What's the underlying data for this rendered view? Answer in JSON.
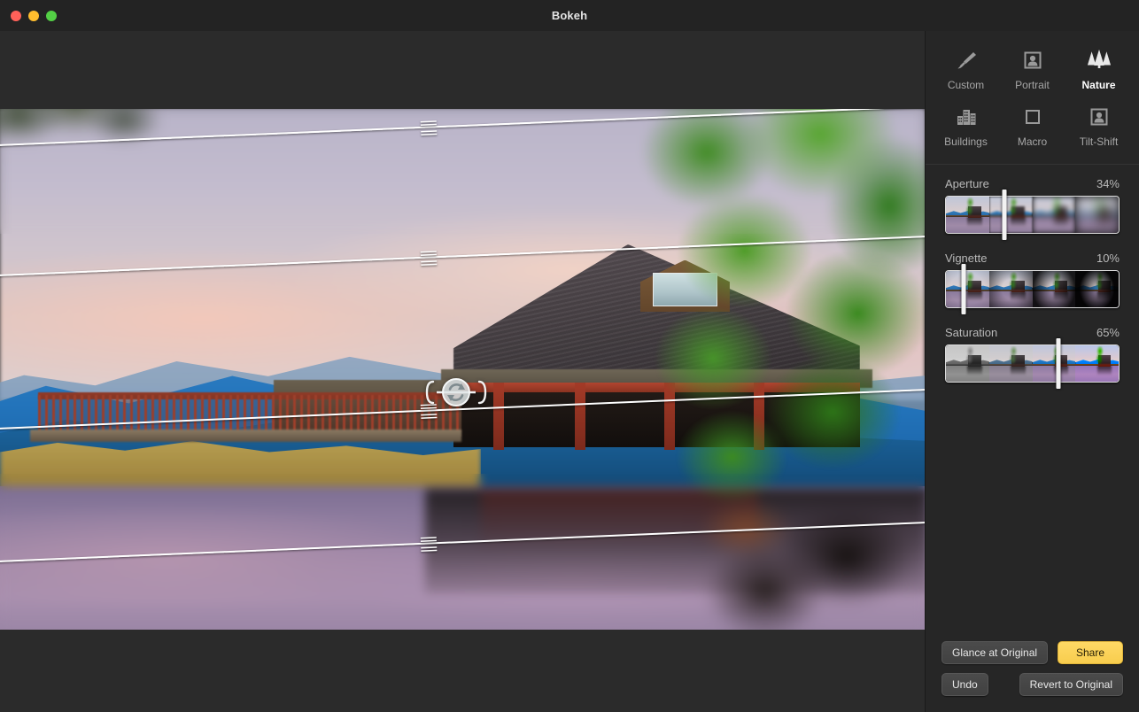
{
  "window": {
    "title": "Bokeh",
    "traffic_lights": [
      {
        "name": "close",
        "color": "#ff6159"
      },
      {
        "name": "minimize",
        "color": "#ffbd2e"
      },
      {
        "name": "zoom",
        "color": "#53cf45"
      }
    ]
  },
  "canvas": {
    "photo_description": "Blurred lakeside wooden lodge with dark tiled roof, red posts and railing, blue mountains and pastel sunset sky reflected in still water",
    "guide_lines": [
      {
        "name": "focus-line-1",
        "top_pct": 3.0,
        "angle_deg": -2.4
      },
      {
        "name": "focus-line-2",
        "top_pct": 28.0,
        "angle_deg": -2.4
      },
      {
        "name": "focus-line-3",
        "top_pct": 57.5,
        "angle_deg": -2.4
      },
      {
        "name": "focus-line-4",
        "top_pct": 83.0,
        "angle_deg": -2.4
      }
    ],
    "rotate_handle": {
      "name": "rotate-focus-handle",
      "icon": "refresh-circle-icon"
    }
  },
  "presets": {
    "items": [
      {
        "id": "custom",
        "label": "Custom",
        "icon": "paintbrush-icon",
        "active": false
      },
      {
        "id": "portrait",
        "label": "Portrait",
        "icon": "portrait-frame-icon",
        "active": false
      },
      {
        "id": "nature",
        "label": "Nature",
        "icon": "trees-icon",
        "active": true
      },
      {
        "id": "buildings",
        "label": "Buildings",
        "icon": "city-buildings-icon",
        "active": false
      },
      {
        "id": "macro",
        "label": "Macro",
        "icon": "empty-square-icon",
        "active": false
      },
      {
        "id": "tilt-shift",
        "label": "Tilt-Shift",
        "icon": "portrait-frame-icon",
        "active": false
      }
    ]
  },
  "sliders": [
    {
      "id": "aperture",
      "label": "Aperture",
      "value_label": "34%",
      "value": 34
    },
    {
      "id": "vignette",
      "label": "Vignette",
      "value_label": "10%",
      "value": 10
    },
    {
      "id": "saturation",
      "label": "Saturation",
      "value_label": "65%",
      "value": 65
    }
  ],
  "footer": {
    "glance": "Glance at Original",
    "share": "Share",
    "undo": "Undo",
    "revert": "Revert to Original",
    "accent_color": "#ffd965"
  }
}
